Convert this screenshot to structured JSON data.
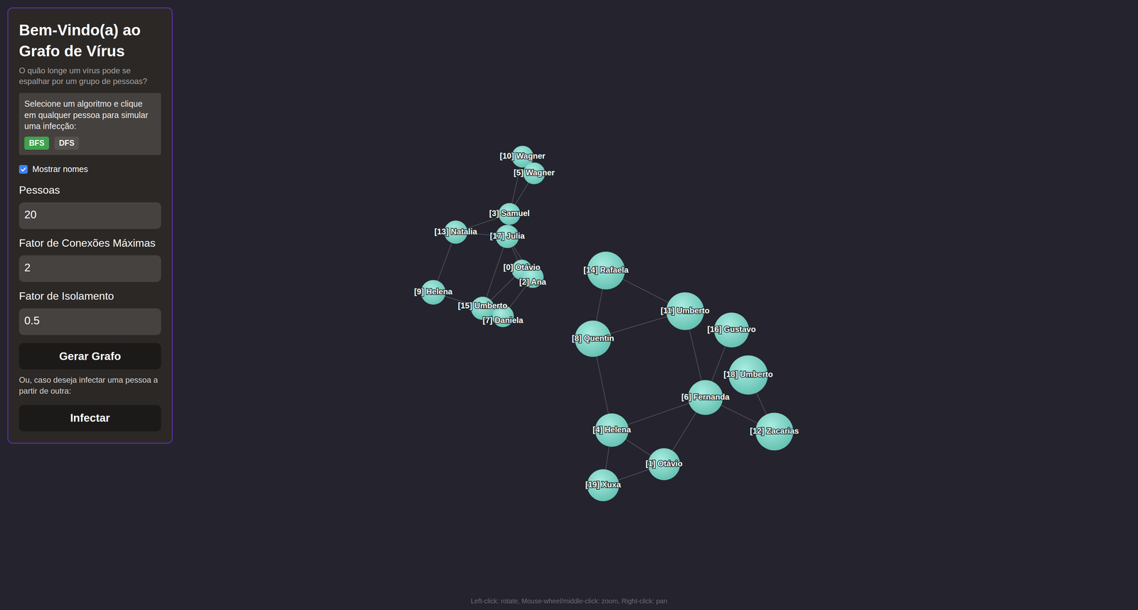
{
  "sidebar": {
    "title": "Bem-Vindo(a) ao Grafo de Vírus",
    "subtitle": "O quão longe um vírus pode se espalhar por um grupo de pessoas?",
    "instructions": "Selecione um algoritmo e clique em qualquer pessoa para simular uma infecção:",
    "algorithms": [
      {
        "label": "BFS",
        "selected": true
      },
      {
        "label": "DFS",
        "selected": false
      }
    ],
    "show_names": {
      "label": "Mostrar nomes",
      "checked": true
    },
    "fields": [
      {
        "label": "Pessoas",
        "value": "20"
      },
      {
        "label": "Fator de Conexões Máximas",
        "value": "2"
      },
      {
        "label": "Fator de Isolamento",
        "value": "0.5"
      }
    ],
    "generate_button": "Gerar Grafo",
    "infect_note": "Ou, caso deseja infectar uma pessoa a partir de outra:",
    "infect_button": "Infectar"
  },
  "graph": {
    "nodes": [
      {
        "label": "[10] Wagner"
      },
      {
        "label": "[5] Wagner"
      },
      {
        "label": "[3] Samuel"
      },
      {
        "label": "[13] Natalia"
      },
      {
        "label": "[17] Julia"
      },
      {
        "label": "[0] Otávio"
      },
      {
        "label": "[2] Ana"
      },
      {
        "label": "[9] Helena"
      },
      {
        "label": "[15] Umberto"
      },
      {
        "label": "[7] Daniela"
      },
      {
        "label": "[14] Rafaela"
      },
      {
        "label": "[11] Umberto"
      },
      {
        "label": "[16] Gustavo"
      },
      {
        "label": "[8] Quentin"
      },
      {
        "label": "[18] Umberto"
      },
      {
        "label": "[6] Fernanda"
      },
      {
        "label": "[12] Zacarias"
      },
      {
        "label": "[4] Helena"
      },
      {
        "label": "[1] Otávio"
      },
      {
        "label": "[19] Xuxa"
      }
    ],
    "edges": [
      [
        0,
        1
      ],
      [
        0,
        2
      ],
      [
        1,
        2
      ],
      [
        2,
        3
      ],
      [
        2,
        4
      ],
      [
        3,
        4
      ],
      [
        3,
        7
      ],
      [
        7,
        8
      ],
      [
        4,
        8
      ],
      [
        4,
        5
      ],
      [
        4,
        6
      ],
      [
        5,
        8
      ],
      [
        6,
        9
      ],
      [
        8,
        9
      ],
      [
        10,
        11
      ],
      [
        10,
        13
      ],
      [
        13,
        11
      ],
      [
        13,
        17
      ],
      [
        11,
        15
      ],
      [
        12,
        15
      ],
      [
        15,
        17
      ],
      [
        15,
        18
      ],
      [
        15,
        16
      ],
      [
        14,
        16
      ],
      [
        17,
        18
      ],
      [
        17,
        19
      ],
      [
        19,
        18
      ]
    ]
  },
  "controls_hint": "Left-click: rotate, Mouse-wheel/middle-click: zoom, Right-click: pan"
}
